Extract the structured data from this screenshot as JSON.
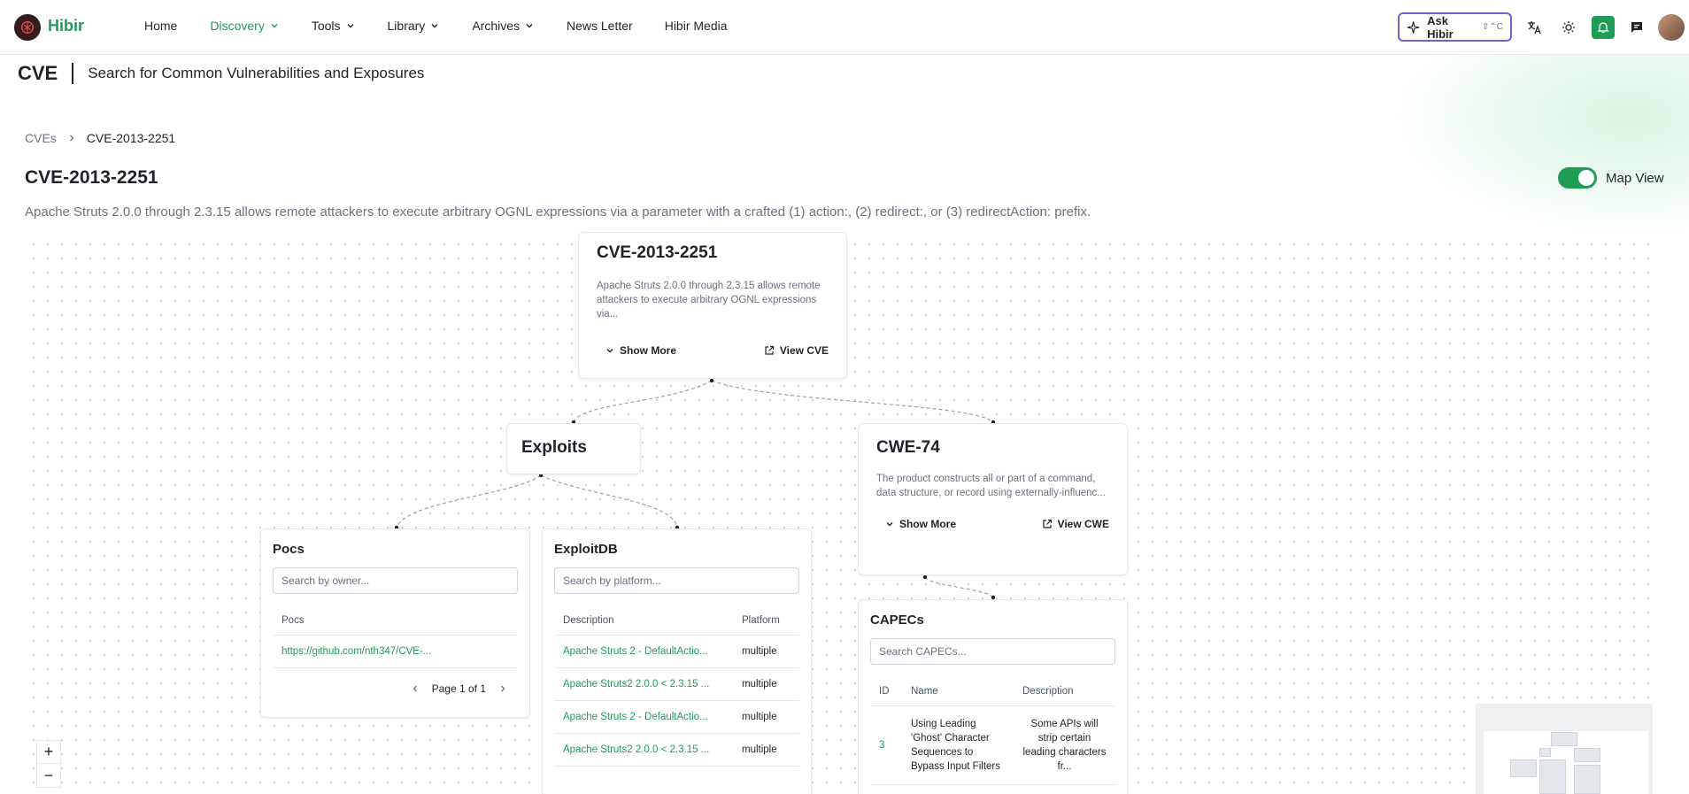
{
  "app": {
    "brand": "Hibir"
  },
  "nav": [
    {
      "label": "Home",
      "dropdown": false,
      "active": false
    },
    {
      "label": "Discovery",
      "dropdown": true,
      "active": true
    },
    {
      "label": "Tools",
      "dropdown": true,
      "active": false
    },
    {
      "label": "Library",
      "dropdown": true,
      "active": false
    },
    {
      "label": "Archives",
      "dropdown": true,
      "active": false
    },
    {
      "label": "News Letter",
      "dropdown": false,
      "active": false
    },
    {
      "label": "Hibir Media",
      "dropdown": false,
      "active": false
    }
  ],
  "ask": {
    "label": "Ask Hibir",
    "shortcut": "⇧⌃C"
  },
  "header": {
    "code": "CVE",
    "subtitle": "Search for Common Vulnerabilities and Exposures"
  },
  "breadcrumb": {
    "parent": "CVEs",
    "current": "CVE-2013-2251"
  },
  "page": {
    "title": "CVE-2013-2251",
    "map_view_label": "Map View",
    "map_view_on": true,
    "description": "Apache Struts 2.0.0 through 2.3.15 allows remote attackers to execute arbitrary OGNL expressions via a parameter with a crafted (1) action:, (2) redirect:, or (3) redirectAction: prefix."
  },
  "cve_node": {
    "title": "CVE-2013-2251",
    "summary": "Apache Struts 2.0.0 through 2.3.15 allows remote attackers to execute arbitrary OGNL expressions via...",
    "show_more": "Show More",
    "view": "View CVE"
  },
  "exploits_node": {
    "title": "Exploits"
  },
  "cwe_node": {
    "title": "CWE-74",
    "summary": "The product constructs all or part of a command, data structure, or record using externally-influenc...",
    "show_more": "Show More",
    "view": "View CWE"
  },
  "pocs": {
    "title": "Pocs",
    "placeholder": "Search by owner...",
    "column": "Pocs",
    "rows": [
      "https://github.com/nth347/CVE-..."
    ],
    "pager": "Page 1 of 1"
  },
  "exploitdb": {
    "title": "ExploitDB",
    "placeholder": "Search by platform...",
    "columns": [
      "Description",
      "Platform"
    ],
    "rows": [
      {
        "description": "Apache Struts 2 - DefaultActio...",
        "platform": "multiple"
      },
      {
        "description": "Apache Struts2 2.0.0 < 2.3.15 ...",
        "platform": "multiple"
      },
      {
        "description": "Apache Struts 2 - DefaultActio...",
        "platform": "multiple"
      },
      {
        "description": "Apache Struts2 2.0.0 < 2.3.15 ...",
        "platform": "multiple"
      }
    ]
  },
  "capecs": {
    "title": "CAPECs",
    "placeholder": "Search CAPECs...",
    "columns": [
      "ID",
      "Name",
      "Description"
    ],
    "rows": [
      {
        "id": "3",
        "name": "Using Leading 'Ghost' Character Sequences to Bypass Input Filters",
        "description": "Some APIs will strip certain leading characters fr..."
      }
    ]
  },
  "zoom": {
    "in": "+",
    "out": "−"
  },
  "colors": {
    "accent": "#1f9d55",
    "ask_border": "#7c5cd6"
  }
}
